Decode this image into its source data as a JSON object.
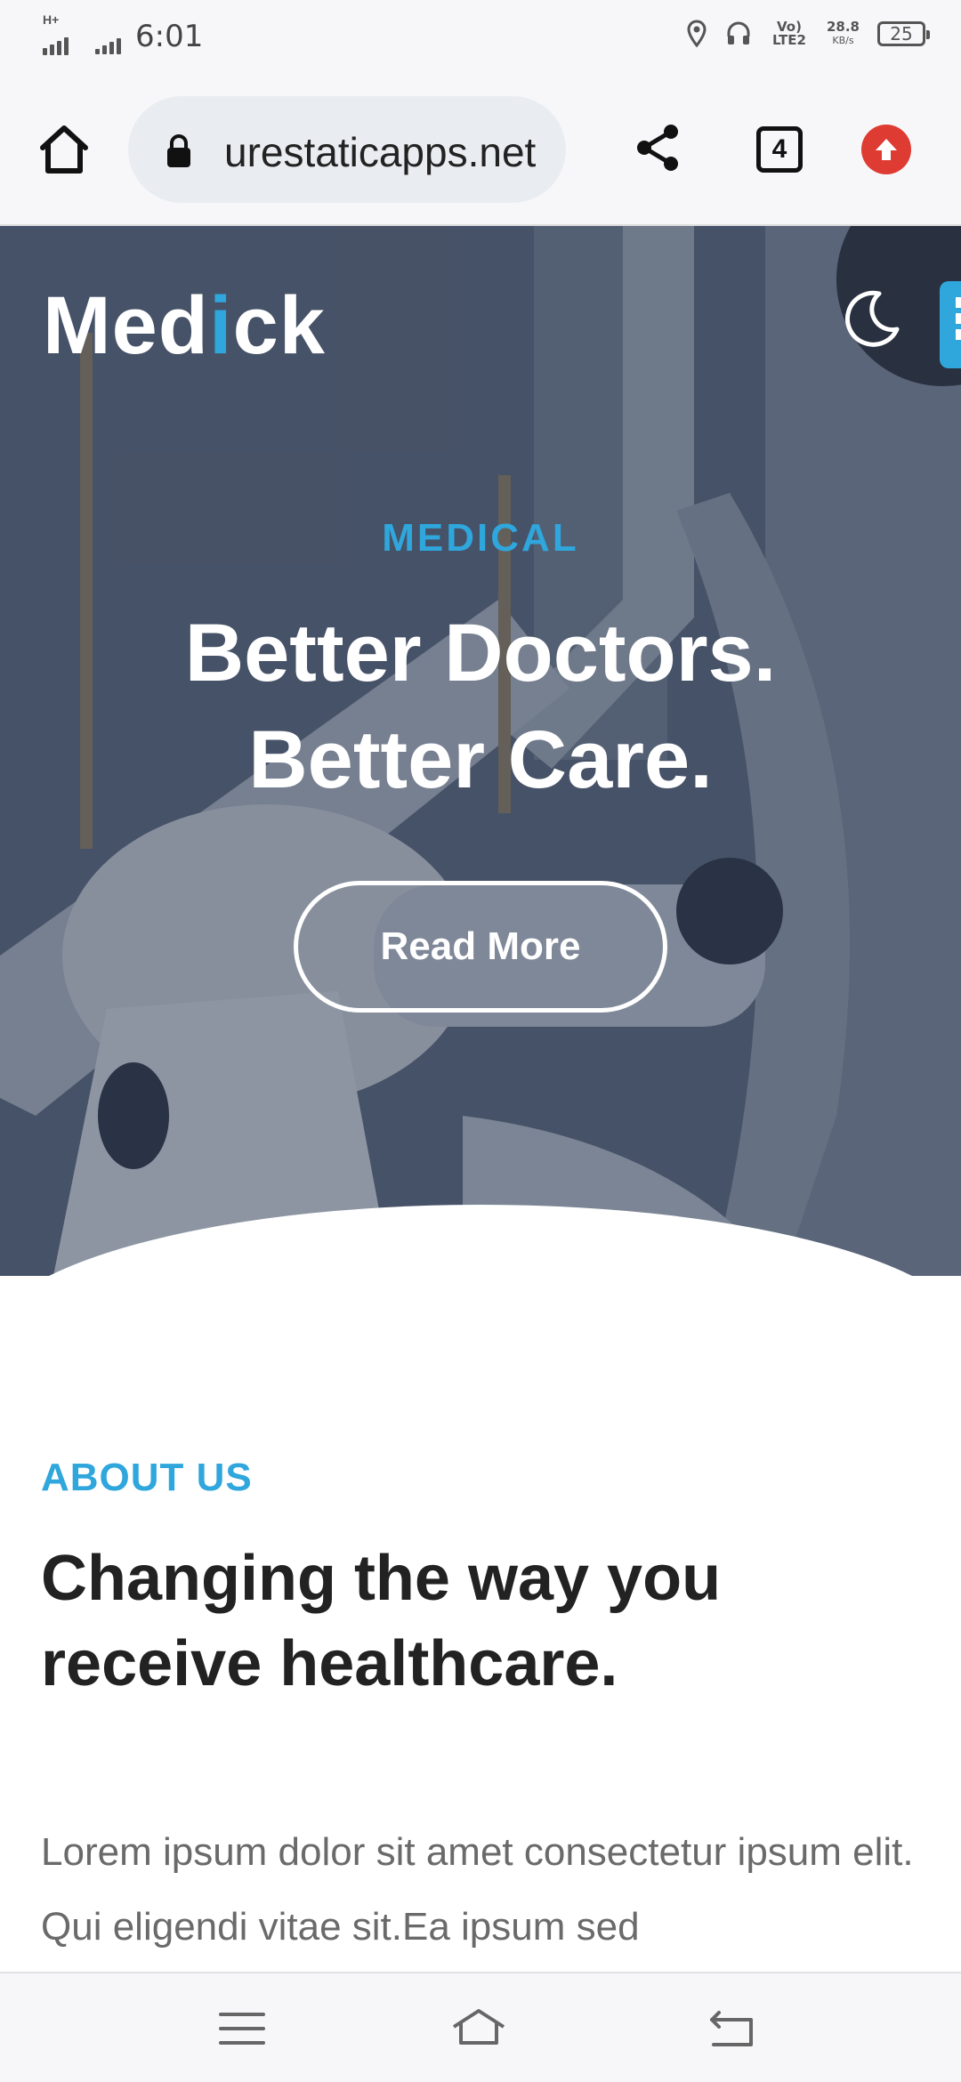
{
  "status_bar": {
    "network_label": "H+",
    "time": "6:01",
    "volte_label": "Vo) LTE2",
    "speed_value": "28.8",
    "speed_unit": "KB/s",
    "battery_level": "25"
  },
  "browser": {
    "url": "urestaticapps.net",
    "tab_count": "4",
    "icons": {
      "home": "home-icon",
      "lock": "lock-icon",
      "share": "share-icon",
      "tabs": "tabs-icon",
      "update": "update-icon"
    }
  },
  "hero": {
    "logo_prefix": "Med",
    "logo_accent": "i",
    "logo_suffix": "ck",
    "kicker": "MEDICAL",
    "headline_line1": "Better Doctors.",
    "headline_line2": "Better Care.",
    "cta_label": "Read More"
  },
  "about": {
    "kicker": "ABOUT US",
    "title_line1": "Changing the way you",
    "title_line2": "receive healthcare.",
    "body": "Lorem ipsum dolor sit amet consectetur ipsum elit. Qui eligendi vitae sit.Ea ipsum sed"
  },
  "nav_bar": {
    "icons": [
      "menu-icon",
      "home-icon",
      "back-icon"
    ]
  },
  "colors": {
    "accent": "#2fa6dc",
    "update_badge": "#de3b32",
    "heading": "#222222",
    "body_text": "#6a6a6a"
  }
}
